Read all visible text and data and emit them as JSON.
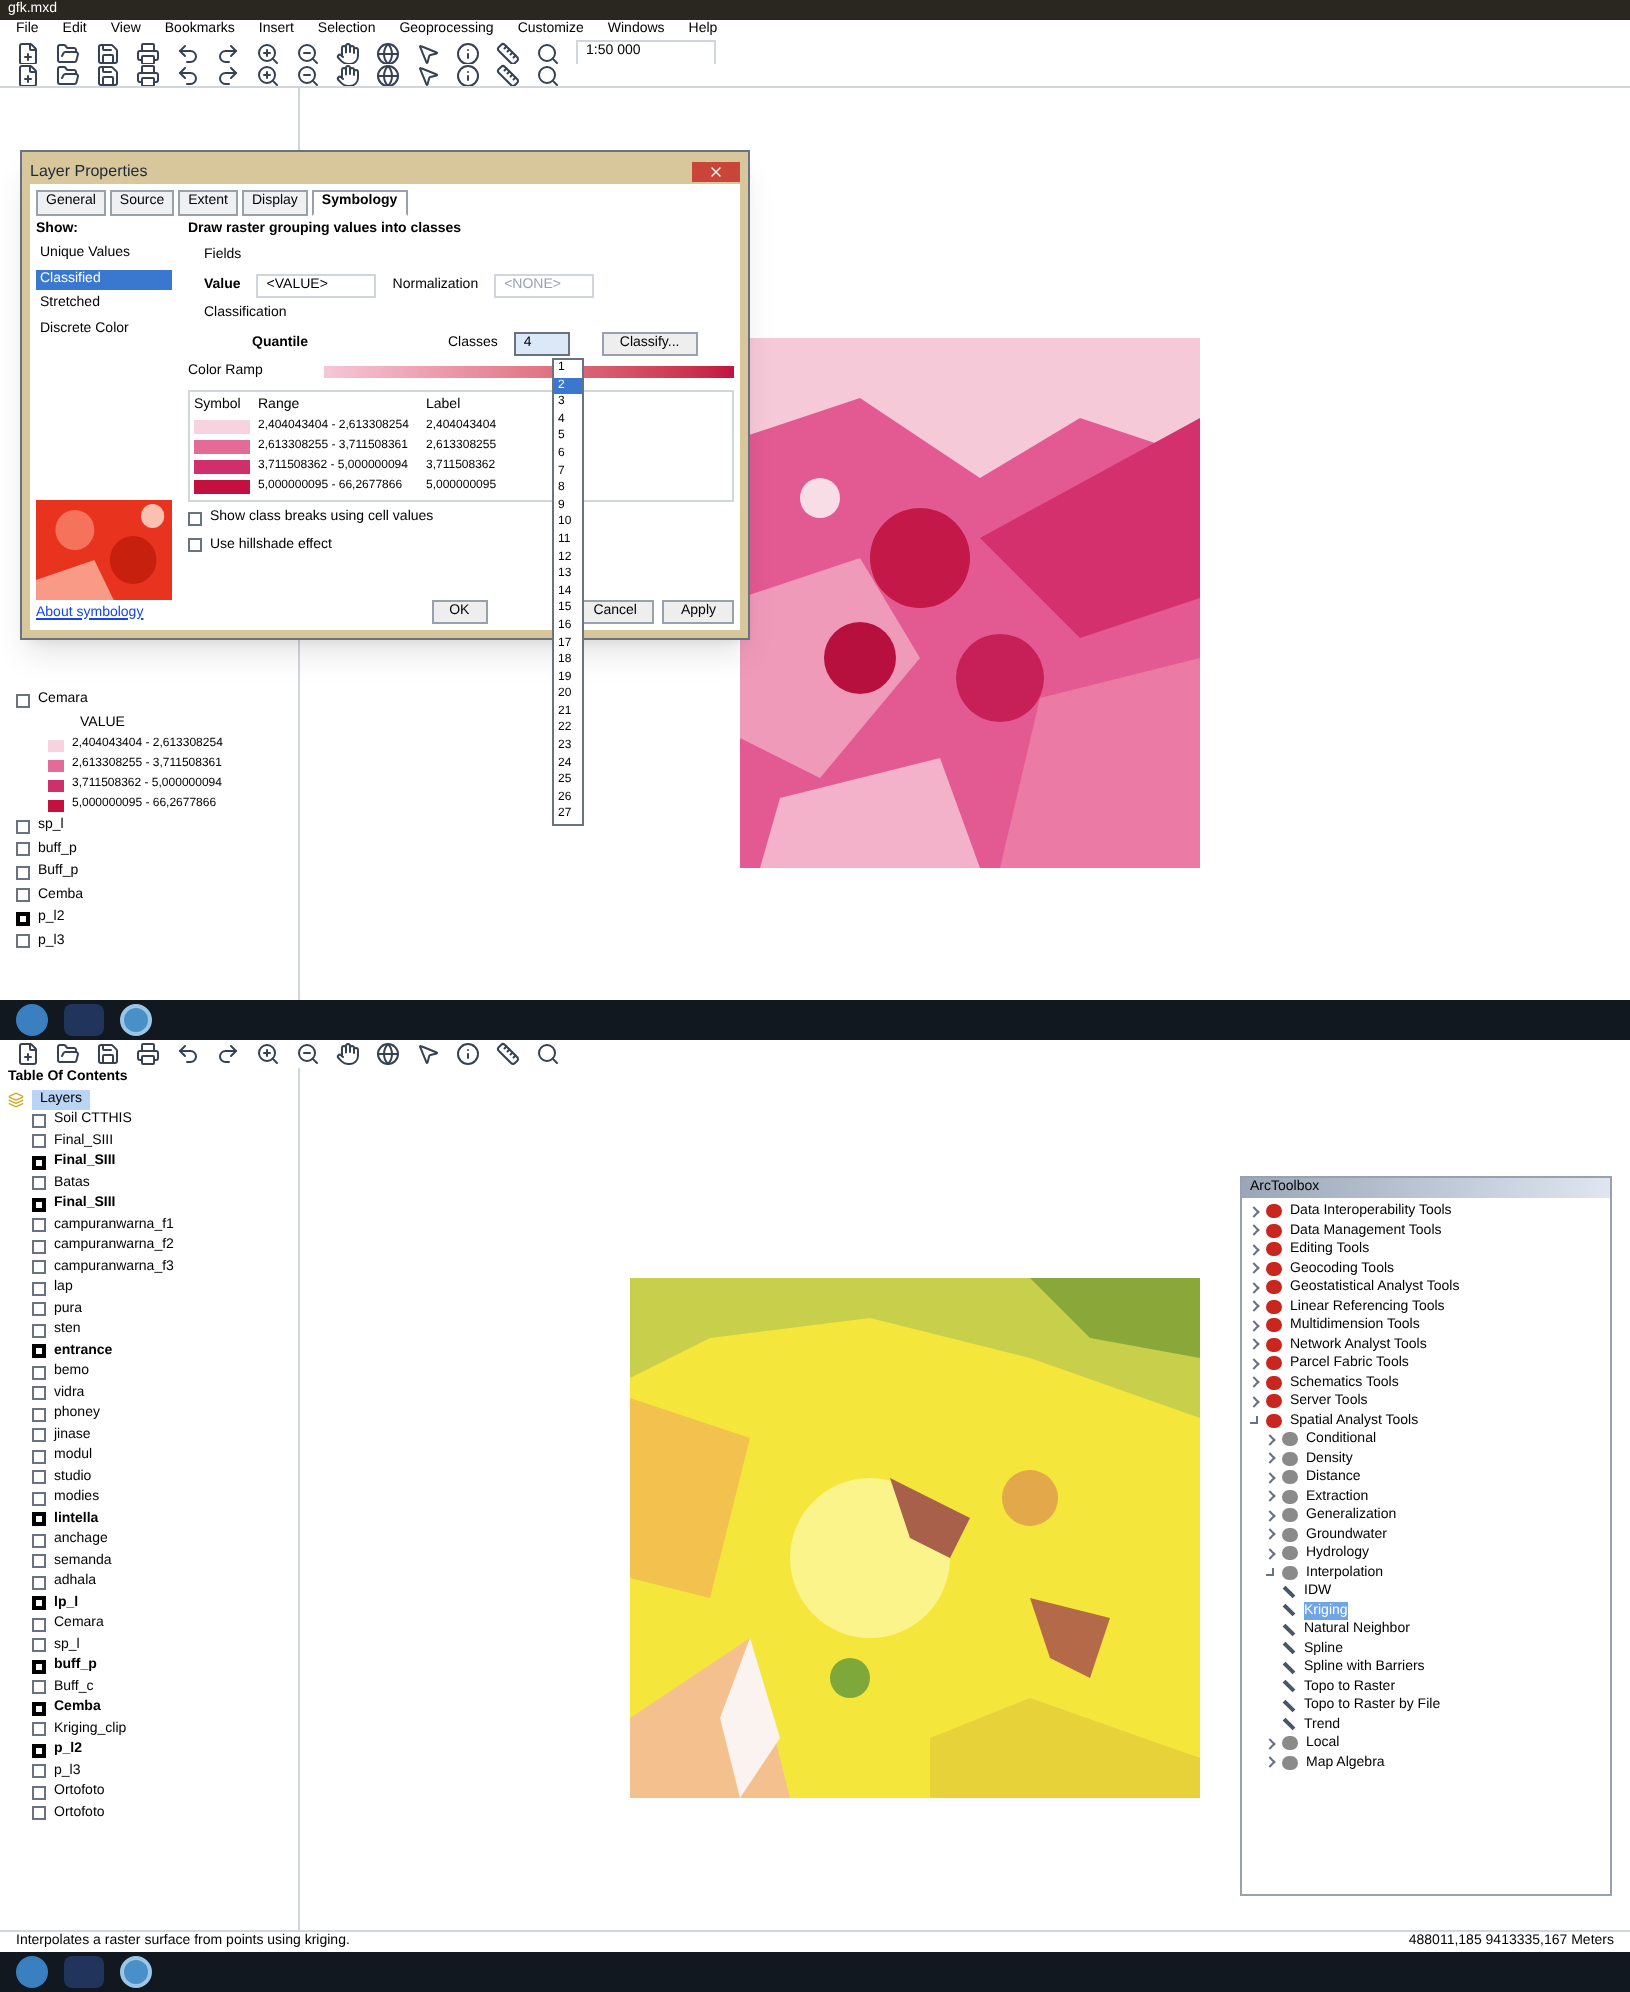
{
  "top": {
    "window_title": "gfk.mxd",
    "menu": [
      "File",
      "Edit",
      "View",
      "Bookmarks",
      "Insert",
      "Selection",
      "Geoprocessing",
      "Customize",
      "Windows",
      "Help"
    ],
    "scale": "1:50 000",
    "toc": [
      {
        "label": "Cemara",
        "checked": false
      },
      {
        "label": "VALUE",
        "kind": "field"
      },
      {
        "label": "2,404043404 - 2,613308254",
        "kind": "class",
        "color": "#f6d3df"
      },
      {
        "label": "2,613308255 - 3,711508361",
        "kind": "class",
        "color": "#e46b98"
      },
      {
        "label": "3,711508362 - 5,000000094",
        "kind": "class",
        "color": "#cf2f6c"
      },
      {
        "label": "5,000000095 - 66,2677866",
        "kind": "class",
        "color": "#c3103f"
      },
      {
        "label": "sp_l",
        "checked": false
      },
      {
        "label": "buff_p",
        "checked": false
      },
      {
        "label": "Buff_p",
        "checked": false
      },
      {
        "label": "Cemba",
        "checked": false
      },
      {
        "label": "p_l2",
        "checked": true
      },
      {
        "label": "p_l3",
        "checked": false
      }
    ],
    "dialog": {
      "title": "Layer Properties",
      "tabs": [
        {
          "label": "General",
          "selected": false
        },
        {
          "label": "Source",
          "selected": false
        },
        {
          "label": "Extent",
          "selected": false
        },
        {
          "label": "Display",
          "selected": false
        },
        {
          "label": "Symbology",
          "selected": true
        }
      ],
      "show_label": "Show:",
      "renderers": [
        {
          "label": "Unique Values",
          "selected": false
        },
        {
          "label": "Classified",
          "selected": true
        },
        {
          "label": "Stretched",
          "selected": false
        },
        {
          "label": "Discrete Color",
          "selected": false
        }
      ],
      "heading": "Draw raster grouping values into classes",
      "fields_label": "Fields",
      "value_label": "Value",
      "value": "<VALUE>",
      "normalization_label": "Normalization",
      "normalization": "<NONE>",
      "classification_label": "Classification",
      "method": "Quantile",
      "classes_label": "Classes",
      "classes": "4",
      "classify_button": "Classify...",
      "color_ramp_label": "Color Ramp",
      "columns": [
        "Symbol",
        "Range",
        "Label"
      ],
      "rows": [
        {
          "range": "2,404043404 - 2,613308254",
          "label": "2,404043404",
          "color": "#f6d3df"
        },
        {
          "range": "2,613308255 - 3,711508361",
          "label": "2,613308255",
          "color": "#e46b98"
        },
        {
          "range": "3,711508362 - 5,000000094",
          "label": "3,711508362",
          "color": "#cf2f6c"
        },
        {
          "range": "5,000000095 - 66,2677866",
          "label": "5,000000095",
          "color": "#c3103f"
        }
      ],
      "options": [
        {
          "label": "Show class breaks using cell values",
          "checked": false
        },
        {
          "label": "Use hillshade effect",
          "checked": false
        }
      ],
      "about_link": "About symbology",
      "buttons": [
        "OK",
        "Cancel",
        "Apply"
      ],
      "dropdown": [
        {
          "label": "1",
          "selected": false
        },
        {
          "label": "2",
          "selected": true
        },
        {
          "label": "3",
          "selected": false
        },
        {
          "label": "4",
          "selected": false
        },
        {
          "label": "5",
          "selected": false
        },
        {
          "label": "6",
          "selected": false
        },
        {
          "label": "7",
          "selected": false
        },
        {
          "label": "8",
          "selected": false
        },
        {
          "label": "9",
          "selected": false
        },
        {
          "label": "10",
          "selected": false
        },
        {
          "label": "11",
          "selected": false
        },
        {
          "label": "12",
          "selected": false
        },
        {
          "label": "13",
          "selected": false
        },
        {
          "label": "14",
          "selected": false
        },
        {
          "label": "15",
          "selected": false
        },
        {
          "label": "16",
          "selected": false
        },
        {
          "label": "17",
          "selected": false
        },
        {
          "label": "18",
          "selected": false
        },
        {
          "label": "19",
          "selected": false
        },
        {
          "label": "20",
          "selected": false
        },
        {
          "label": "21",
          "selected": false
        },
        {
          "label": "22",
          "selected": false
        },
        {
          "label": "23",
          "selected": false
        },
        {
          "label": "24",
          "selected": false
        },
        {
          "label": "25",
          "selected": false
        },
        {
          "label": "26",
          "selected": false
        },
        {
          "label": "27",
          "selected": false
        }
      ]
    }
  },
  "bottom": {
    "toc_title": "Table Of Contents",
    "root": "Layers",
    "layers": [
      {
        "label": "Soil CTTHIS",
        "checked": false
      },
      {
        "label": "Final_SIII",
        "checked": false
      },
      {
        "label": "Final_SIII",
        "checked": true
      },
      {
        "label": "Batas",
        "checked": false
      },
      {
        "label": "Final_SIII",
        "checked": true
      },
      {
        "label": "campuranwarna_f1",
        "checked": false
      },
      {
        "label": "campuranwarna_f2",
        "checked": false
      },
      {
        "label": "campuranwarna_f3",
        "checked": false
      },
      {
        "label": "lap",
        "checked": false
      },
      {
        "label": "pura",
        "checked": false
      },
      {
        "label": "sten",
        "checked": false
      },
      {
        "label": "entrance",
        "checked": true
      },
      {
        "label": "bemo",
        "checked": false
      },
      {
        "label": "vidra",
        "checked": false
      },
      {
        "label": "phoney",
        "checked": false
      },
      {
        "label": "jinase",
        "checked": false
      },
      {
        "label": "modul",
        "checked": false
      },
      {
        "label": "studio",
        "checked": false
      },
      {
        "label": "modies",
        "checked": false
      },
      {
        "label": "lintella",
        "checked": true
      },
      {
        "label": "anchage",
        "checked": false
      },
      {
        "label": "semanda",
        "checked": false
      },
      {
        "label": "adhala",
        "checked": false
      },
      {
        "label": "lp_l",
        "checked": true
      },
      {
        "label": "Cemara",
        "checked": false
      },
      {
        "label": "sp_l",
        "checked": false
      },
      {
        "label": "buff_p",
        "checked": true
      },
      {
        "label": "Buff_c",
        "checked": false
      },
      {
        "label": "Cemba",
        "checked": true
      },
      {
        "label": "Kriging_clip",
        "checked": false
      },
      {
        "label": "p_l2",
        "checked": true
      },
      {
        "label": "p_l3",
        "checked": false
      },
      {
        "label": "Ortofoto",
        "checked": false
      },
      {
        "label": "Ortofoto",
        "checked": false
      }
    ],
    "toolbox": {
      "title": "ArcToolbox",
      "items": [
        {
          "label": "Data Interoperability Tools",
          "kind": "toolbox",
          "expanded": false
        },
        {
          "label": "Data Management Tools",
          "kind": "toolbox",
          "expanded": false
        },
        {
          "label": "Editing Tools",
          "kind": "toolbox",
          "expanded": false
        },
        {
          "label": "Geocoding Tools",
          "kind": "toolbox",
          "expanded": false
        },
        {
          "label": "Geostatistical Analyst Tools",
          "kind": "toolbox",
          "expanded": false
        },
        {
          "label": "Linear Referencing Tools",
          "kind": "toolbox",
          "expanded": false
        },
        {
          "label": "Multidimension Tools",
          "kind": "toolbox",
          "expanded": false
        },
        {
          "label": "Network Analyst Tools",
          "kind": "toolbox",
          "expanded": false
        },
        {
          "label": "Parcel Fabric Tools",
          "kind": "toolbox",
          "expanded": false
        },
        {
          "label": "Schematics Tools",
          "kind": "toolbox",
          "expanded": false
        },
        {
          "label": "Server Tools",
          "kind": "toolbox",
          "expanded": false
        },
        {
          "label": "Spatial Analyst Tools",
          "kind": "toolbox",
          "expanded": true,
          "children": [
            {
              "label": "Conditional",
              "kind": "toolset",
              "expanded": false
            },
            {
              "label": "Density",
              "kind": "toolset",
              "expanded": false
            },
            {
              "label": "Distance",
              "kind": "toolset",
              "expanded": false
            },
            {
              "label": "Extraction",
              "kind": "toolset",
              "expanded": false
            },
            {
              "label": "Generalization",
              "kind": "toolset",
              "expanded": false
            },
            {
              "label": "Groundwater",
              "kind": "toolset",
              "expanded": false
            },
            {
              "label": "Hydrology",
              "kind": "toolset",
              "expanded": false
            },
            {
              "label": "Interpolation",
              "kind": "toolset",
              "expanded": true,
              "children": [
                {
                  "label": "IDW",
                  "kind": "tool",
                  "selected": false
                },
                {
                  "label": "Kriging",
                  "kind": "tool",
                  "selected": true
                },
                {
                  "label": "Natural Neighbor",
                  "kind": "tool",
                  "selected": false
                },
                {
                  "label": "Spline",
                  "kind": "tool",
                  "selected": false
                },
                {
                  "label": "Spline with Barriers",
                  "kind": "tool",
                  "selected": false
                },
                {
                  "label": "Topo to Raster",
                  "kind": "tool",
                  "selected": false
                },
                {
                  "label": "Topo to Raster by File",
                  "kind": "tool",
                  "selected": false
                },
                {
                  "label": "Trend",
                  "kind": "tool",
                  "selected": false
                }
              ]
            },
            {
              "label": "Local",
              "kind": "toolset",
              "expanded": false
            },
            {
              "label": "Map Algebra",
              "kind": "toolset",
              "expanded": false
            }
          ]
        }
      ]
    },
    "status": "Interpolates a raster surface from points using kriging.",
    "coordinates": "488011,185 9413335,167 Meters"
  }
}
